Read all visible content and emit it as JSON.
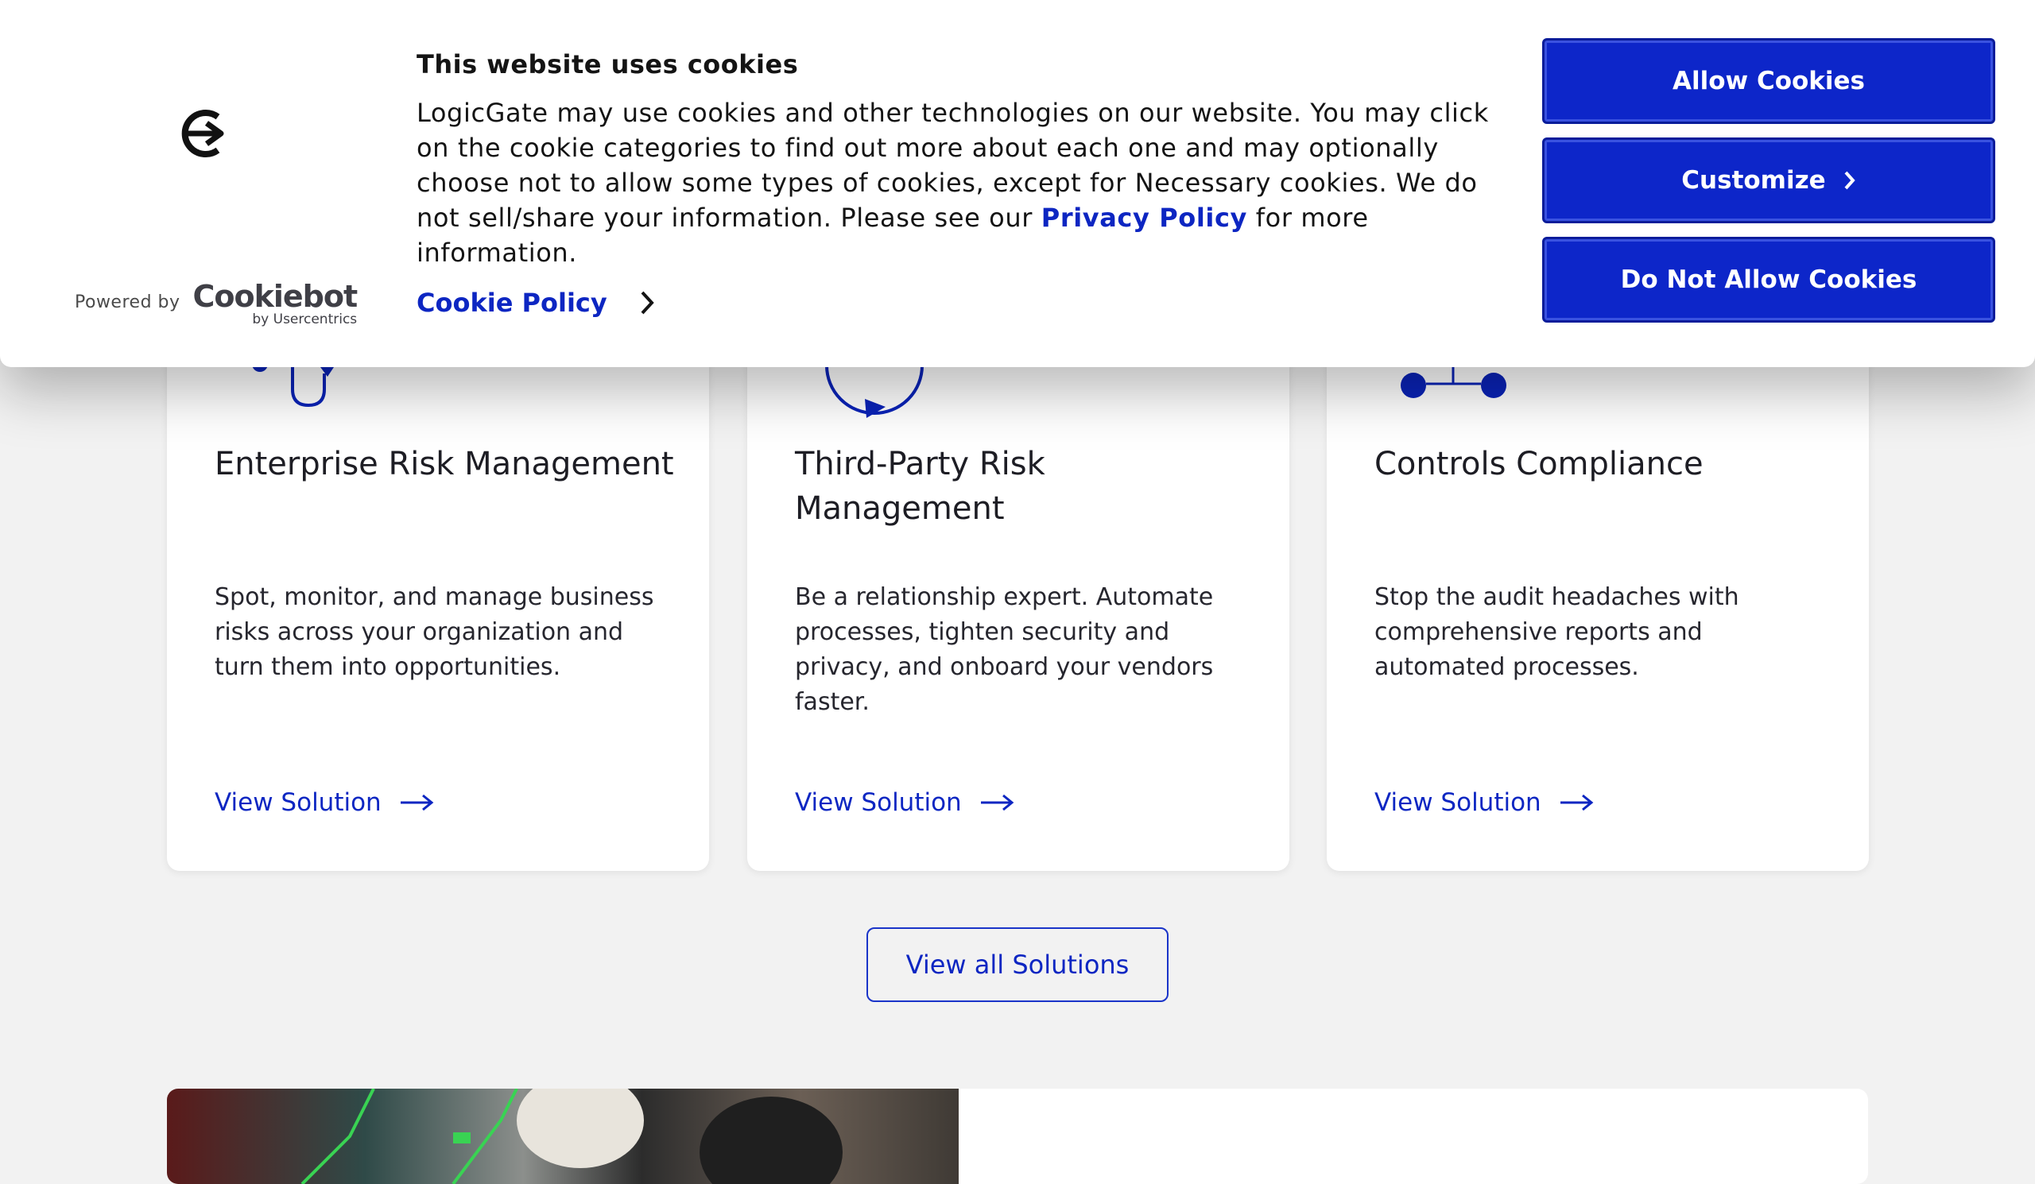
{
  "cookie_banner": {
    "title": "This website uses cookies",
    "body_before_link": "LogicGate may use cookies and other technologies on our website. You may click on the cookie categories to find out more about each one and may optionally choose not to allow some types of cookies, except for Necessary cookies.  We do not sell/share your information. Please see our ",
    "privacy_link": "Privacy Policy",
    "body_after_link": " for more information.",
    "cookie_policy_link": "Cookie Policy",
    "powered_by": "Powered by",
    "cookiebot_name": "Cookiebot",
    "cookiebot_sub": "by Usercentrics",
    "buttons": {
      "allow": "Allow Cookies",
      "customize": "Customize",
      "deny": "Do Not Allow Cookies"
    }
  },
  "solutions": [
    {
      "icon": "erm-flow-icon",
      "title": "Enterprise Risk Management",
      "description": "Spot, monitor, and manage business risks across your organization and turn them into opportunities.",
      "link": "View Solution"
    },
    {
      "icon": "cycle-arrow-icon",
      "title": "Third-Party Risk Management",
      "description": "Be a relationship expert. Automate processes, tighten security and privacy, and onboard your vendors faster.",
      "link": "View Solution"
    },
    {
      "icon": "node-connector-icon",
      "title": "Controls Compliance",
      "description": "Stop the audit headaches with comprehensive reports and automated processes.",
      "link": "View Solution"
    }
  ],
  "view_all_label": "View all Solutions",
  "colors": {
    "brand_blue": "#0d26c9",
    "page_bg": "#f2f2f2"
  }
}
